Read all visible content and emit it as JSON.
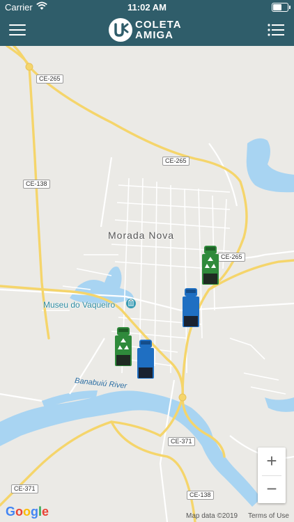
{
  "status_bar": {
    "carrier": "Carrier",
    "time": "11:02 AM",
    "battery_icon": "battery-icon",
    "wifi_icon": "wifi-icon"
  },
  "nav": {
    "logo_line1": "COLETA",
    "logo_line2": "AMIGA",
    "menu_icon": "hamburger-menu-icon",
    "list_icon": "list-icon",
    "bar_color": "#2f5d6a"
  },
  "map": {
    "town": "Morada Nova",
    "poi": "Museu do Vaqueiro",
    "river": "Banabuiú River",
    "road_labels": [
      "CE-265",
      "CE-265",
      "CE-138",
      "CE-265",
      "CE-371",
      "CE-371",
      "CE-138"
    ],
    "zoom_in": "+",
    "zoom_out": "−",
    "google": "Google",
    "map_data": "Map data ©2019",
    "terms": "Terms of Use"
  },
  "trucks": [
    {
      "type": "recycling",
      "color": "#2f8a3b"
    },
    {
      "type": "garbage",
      "color": "#1f6fc2"
    },
    {
      "type": "recycling",
      "color": "#2f8a3b"
    },
    {
      "type": "garbage",
      "color": "#1f6fc2"
    }
  ]
}
